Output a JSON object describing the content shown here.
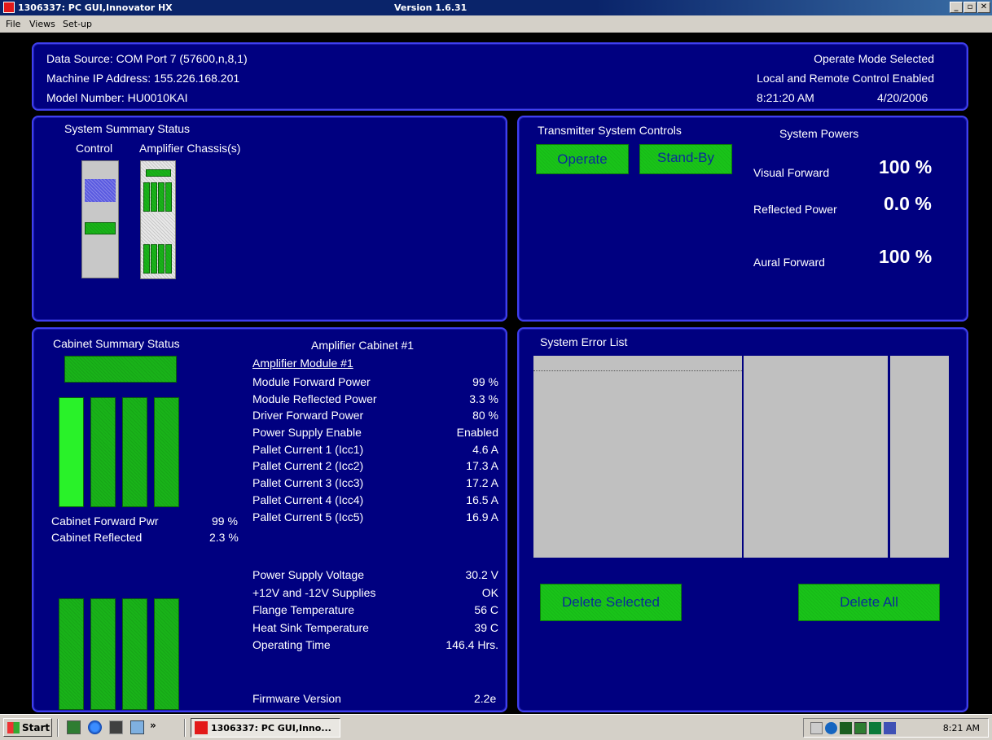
{
  "window": {
    "title": "1306337: PC GUI,Innovator HX",
    "version": "Version 1.6.31",
    "minimize": "_",
    "maximize": "▫",
    "close": "✕"
  },
  "menu": {
    "file": "File",
    "views": "Views",
    "setup": "Set-up"
  },
  "header": {
    "data_source": "Data Source: COM Port 7 (57600,n,8,1)",
    "ip": "Machine IP Address: 155.226.168.201",
    "model": "Model Number: HU0010KAI",
    "mode": "Operate Mode Selected",
    "control": "Local and Remote Control Enabled",
    "time": "8:21:20 AM",
    "date": "4/20/2006"
  },
  "system_summary": {
    "title": "System Summary Status",
    "control_label": "Control",
    "chassis_label": "Amplifier Chassis(s)"
  },
  "controls": {
    "title": "Transmitter System Controls",
    "operate": "Operate",
    "standby": "Stand-By"
  },
  "powers": {
    "title": "System Powers",
    "visual_label": "Visual Forward",
    "visual_value": "100 %",
    "reflected_label": "Reflected Power",
    "reflected_value": "0.0 %",
    "aural_label": "Aural Forward",
    "aural_value": "100 %"
  },
  "cabinet_summary": {
    "title": "Cabinet Summary Status",
    "fwd_label": "Cabinet Forward Pwr",
    "fwd_value": "99 %",
    "refl_label": "Cabinet Reflected",
    "refl_value": "2.3 %"
  },
  "amp_cabinet": {
    "title": "Amplifier Cabinet #1",
    "module_title": "Amplifier Module #1",
    "rows": [
      {
        "label": "Module Forward Power",
        "value": "99 %"
      },
      {
        "label": "Module Reflected Power",
        "value": "3.3 %"
      },
      {
        "label": "Driver Forward Power",
        "value": "80 %"
      },
      {
        "label": "Power Supply Enable",
        "value": "Enabled"
      },
      {
        "label": "Pallet Current 1 (Icc1)",
        "value": "4.6 A"
      },
      {
        "label": "Pallet Current 2 (Icc2)",
        "value": "17.3 A"
      },
      {
        "label": "Pallet Current 3 (Icc3)",
        "value": "17.2 A"
      },
      {
        "label": "Pallet Current 4 (Icc4)",
        "value": "16.5 A"
      },
      {
        "label": "Pallet Current 5 (Icc5)",
        "value": "16.9 A"
      }
    ],
    "rows2": [
      {
        "label": "Power Supply Voltage",
        "value": "30.2 V"
      },
      {
        "label": "+12V and -12V Supplies",
        "value": "OK"
      },
      {
        "label": "Flange Temperature",
        "value": "56 C"
      },
      {
        "label": "Heat Sink Temperature",
        "value": "39 C"
      },
      {
        "label": "Operating Time",
        "value": "146.4 Hrs."
      }
    ],
    "firmware_label": "Firmware Version",
    "firmware_value": "2.2e"
  },
  "errors": {
    "title": "System Error List",
    "delete_selected": "Delete Selected",
    "delete_all": "Delete All"
  },
  "taskbar": {
    "start": "Start",
    "chevron": "»",
    "task": "1306337: PC GUI,Inno...",
    "clock": "8:21 AM"
  },
  "colors": {
    "panel": "#000080",
    "panel_border": "#3f3ff0",
    "ok_green": "#19c419",
    "bright_green": "#29f229"
  }
}
